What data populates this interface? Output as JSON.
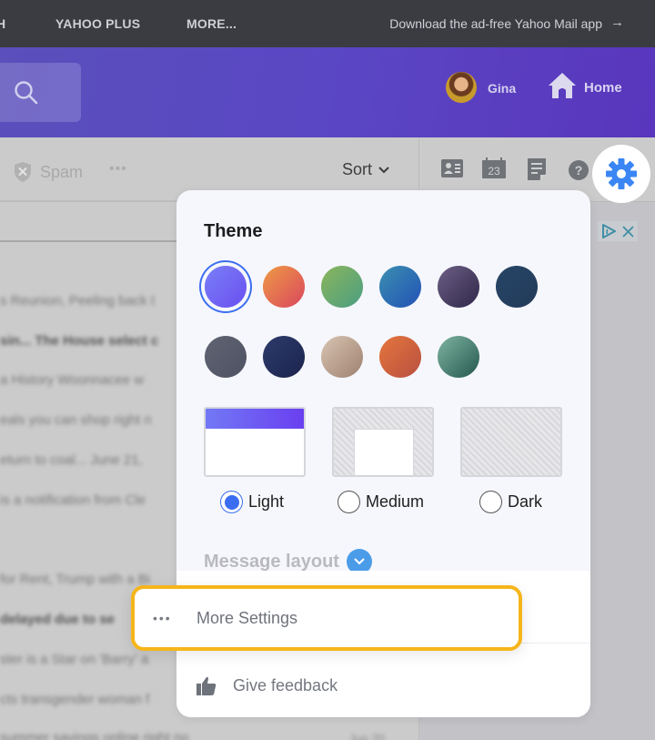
{
  "topbar": {
    "nav_items": [
      "H",
      "YAHOO PLUS",
      "MORE..."
    ],
    "promo_text": "Download the ad-free Yahoo Mail app",
    "promo_arrow": "→"
  },
  "header": {
    "search_icon": "search-icon",
    "user_name": "Gina",
    "home_label": "Home"
  },
  "toolbar": {
    "spam_label": "Spam",
    "more_label": "•••",
    "sort_label": "Sort"
  },
  "rail": {
    "icons": [
      "contacts-icon",
      "calendar-icon",
      "notepad-icon",
      "help-icon",
      "settings-gear-icon"
    ],
    "calendar_day": "23",
    "ad_choices_icon": "ad-choices-icon",
    "ad_close_icon": "close-icon"
  },
  "mail_list": {
    "rows": [
      {
        "text": "s Reunion, Peeling back t",
        "bold": false
      },
      {
        "text": "sin...   The House select c",
        "bold": true
      },
      {
        "text": "a History Woonnacee w",
        "bold": false
      },
      {
        "text": "eals you can shop right n",
        "bold": false
      },
      {
        "text": "eturn to coal... June 21,",
        "bold": false
      },
      {
        "text": "is a notification from Cle",
        "bold": false
      },
      {
        "text": "for Rent, Trump with a Bi",
        "bold": false
      },
      {
        "text": "delayed due to se",
        "bold": true
      },
      {
        "text": "ster is a Star on 'Barry' a",
        "bold": false
      },
      {
        "text": "cts transgender woman f",
        "bold": false
      },
      {
        "text": "summer savings online right no",
        "bold": false
      }
    ],
    "last_date": "Jun 20"
  },
  "settings_popup": {
    "theme_title": "Theme",
    "themes": [
      {
        "name": "purple",
        "colors": [
          "#7a7ff7",
          "#6a4ff0"
        ],
        "selected": true
      },
      {
        "name": "sunset",
        "colors": [
          "#ef9a44",
          "#d9475f"
        ],
        "selected": false
      },
      {
        "name": "green",
        "colors": [
          "#8cb55c",
          "#4a9e82"
        ],
        "selected": false
      },
      {
        "name": "blue",
        "colors": [
          "#3a8fb0",
          "#2352b6"
        ],
        "selected": false
      },
      {
        "name": "plum",
        "colors": [
          "#6c5f86",
          "#2f2748"
        ],
        "selected": false
      },
      {
        "name": "navy",
        "colors": [
          "#274566",
          "#223a5a"
        ],
        "selected": false
      },
      {
        "name": "slate",
        "colors": [
          "#5f6372",
          "#4e5262"
        ],
        "selected": false
      },
      {
        "name": "mountain",
        "colors": [
          "#2d3a6b",
          "#1b244d"
        ],
        "selected": false
      },
      {
        "name": "camper",
        "colors": [
          "#d8c4b2",
          "#9e8070"
        ],
        "selected": false
      },
      {
        "name": "desert",
        "colors": [
          "#e5763d",
          "#b85040"
        ],
        "selected": false
      },
      {
        "name": "lake",
        "colors": [
          "#7fb3a0",
          "#24584f"
        ],
        "selected": false
      }
    ],
    "modes": [
      {
        "label": "Light",
        "checked": true
      },
      {
        "label": "Medium",
        "checked": false
      },
      {
        "label": "Dark",
        "checked": false
      }
    ],
    "message_layout_label": "Message layout",
    "more_settings_label": "More Settings",
    "more_settings_dots": "•••",
    "feedback_label": "Give feedback"
  },
  "colors": {
    "accent_blue": "#3a6df0",
    "highlight_yellow": "#f6b51a",
    "header_purple": "#5a47c4"
  }
}
